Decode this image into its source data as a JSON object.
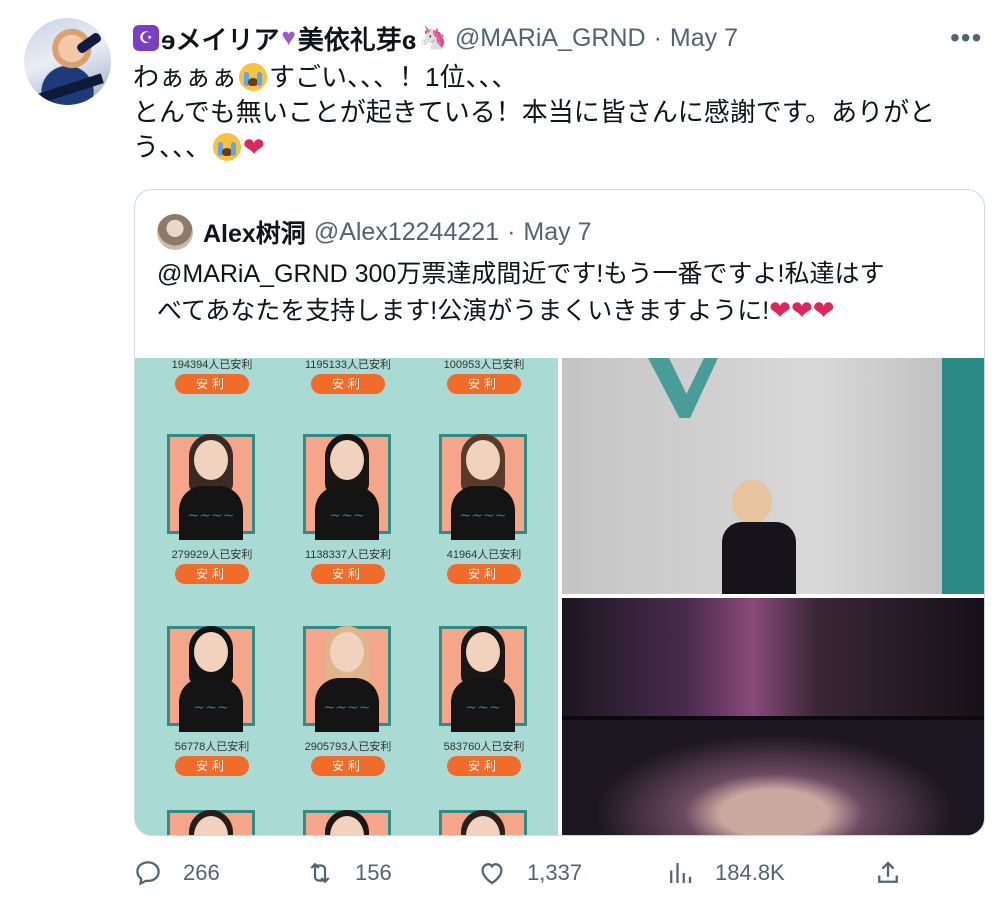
{
  "tweet": {
    "display_name": "ɘメイリア",
    "display_name_2": "美依礼芽ɞ",
    "handle": "@MARiA_GRND",
    "dot": "·",
    "date": "May 7",
    "text_line1_a": "わぁぁぁ",
    "text_line1_b": "すごい、、、！1位、、、",
    "text_line2": "とんでも無いことが起きている！本当に皆さんに感謝です。ありがと",
    "text_line3": "う、、、"
  },
  "quote": {
    "display_name": "Alex树洞",
    "handle": "@Alex12244221",
    "dot": "·",
    "date": "May 7",
    "text_line1": "@MARiA_GRND 300万票達成間近です!もう一番ですよ!私達はす",
    "text_line2": "べてあなたを支持します!公演がうまくいきますように!"
  },
  "vote_grid": {
    "button_label": "安利",
    "rows": [
      [
        "194394人已安利",
        "1195133人已安利",
        "100953人已安利"
      ],
      [
        "279929人已安利",
        "1138337人已安利",
        "41964人已安利"
      ],
      [
        "56778人已安利",
        "2905793人已安利",
        "583760人已安利"
      ]
    ]
  },
  "actions": {
    "replies": "266",
    "retweets": "156",
    "likes": "1,337",
    "views": "184.8K"
  },
  "icons": {
    "more": "more-horizontal-icon",
    "reply": "reply-icon",
    "retweet": "retweet-icon",
    "like": "heart-icon",
    "views": "views-bar-chart-icon",
    "share": "share-icon"
  },
  "colors": {
    "text": "#0f1419",
    "secondary": "#536471",
    "border": "#cfd9de",
    "heart_red": "#e0245e",
    "vote_button": "#f26b2a"
  }
}
